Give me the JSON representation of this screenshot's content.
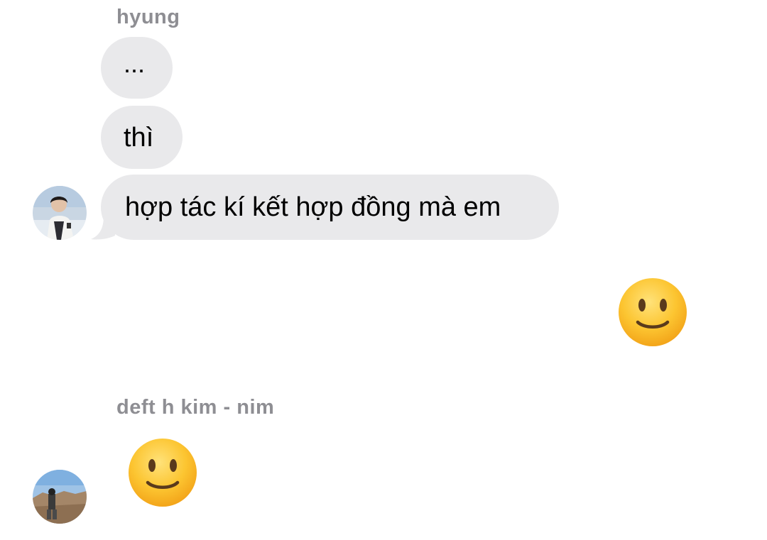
{
  "thread": {
    "group1": {
      "sender": "hyung",
      "messages": [
        "...",
        "thì",
        "hợp tác kí kết hợp đồng mà em"
      ],
      "avatar_icon": "person-photo-avatar"
    },
    "outgoing": {
      "reaction": "slightly-smiling-face-emoji",
      "bubble_color": "#e9e9eb"
    },
    "group2": {
      "sender": "deft h kim - nim",
      "reaction": "slightly-smiling-face-emoji",
      "avatar_icon": "landscape-photo-avatar"
    }
  }
}
